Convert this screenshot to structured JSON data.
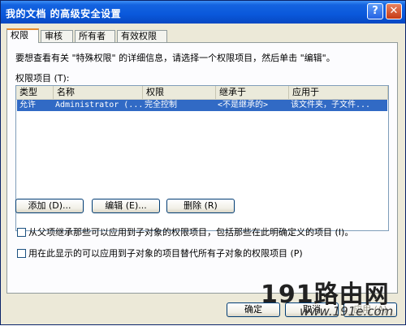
{
  "window": {
    "title": "我的文档 的高级安全设置"
  },
  "titlebar": {
    "help_glyph": "?",
    "close_glyph": "✕"
  },
  "tabs": [
    {
      "label": "权限"
    },
    {
      "label": "审核"
    },
    {
      "label": "所有者"
    },
    {
      "label": "有效权限"
    }
  ],
  "panel": {
    "intro": "要想查看有关 \"特殊权限\" 的详细信息，请选择一个权限项目，然后单击 \"编辑\"。",
    "entries_label": "权限项目 (T):"
  },
  "table": {
    "columns": [
      "类型",
      "名称",
      "权限",
      "继承于",
      "应用于"
    ],
    "rows": [
      {
        "type": "允许",
        "name": "Administrator (...",
        "permission": "完全控制",
        "inherited": "<不是继承的>",
        "applies_to": "该文件夹，子文件..."
      }
    ]
  },
  "buttons": {
    "add": "添加 (D)...",
    "edit": "编辑 (E)...",
    "remove": "删除 (R)",
    "ok": "确定",
    "cancel": "取消",
    "apply": "应用 (A)"
  },
  "options": {
    "inherit": "从父项继承那些可以应用到子对象的权限项目，包括那些在此明确定义的项目 (I)。",
    "replace": "用在此显示的可以应用到子对象的项目替代所有子对象的权限项目 (P)"
  },
  "watermark": {
    "brand": "191路由网",
    "url": "www.191e.com"
  },
  "colors": {
    "title_bar": "#0a58db",
    "selection": "#316ac5",
    "active_tab_accent": "#e68b2c"
  }
}
